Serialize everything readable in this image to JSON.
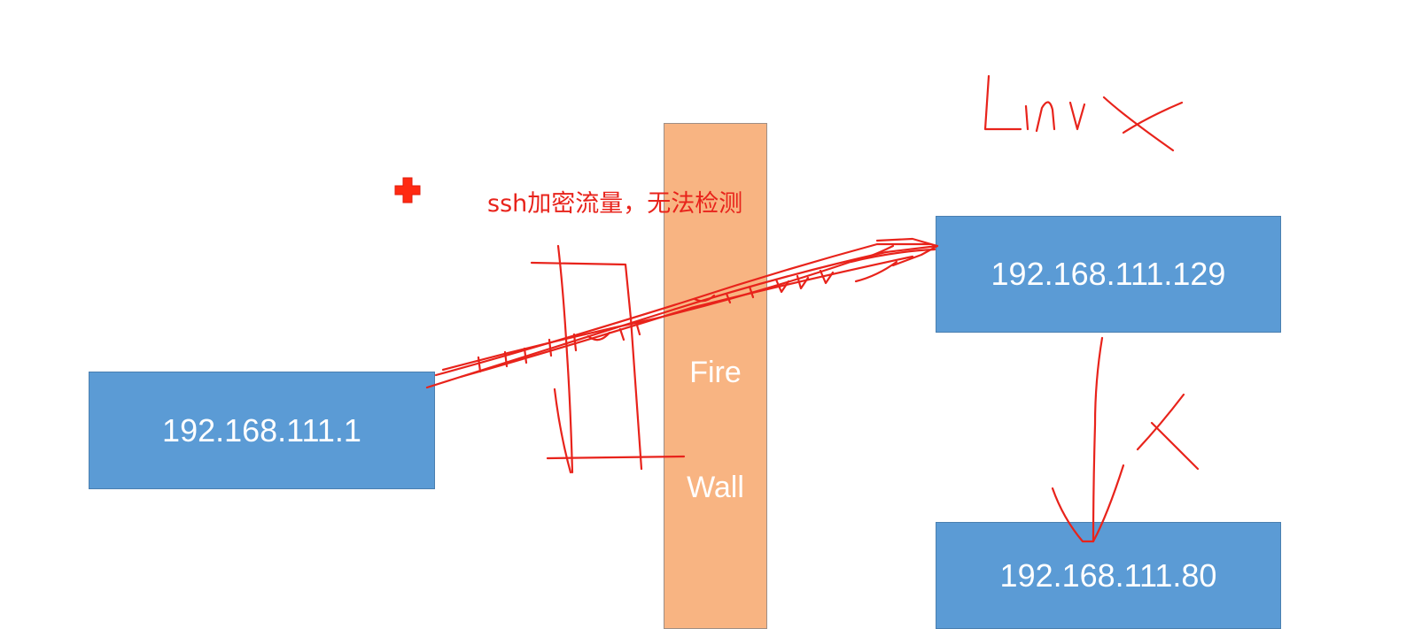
{
  "nodes": {
    "left": {
      "label": "192.168.111.1"
    },
    "right_top": {
      "label": "192.168.111.129"
    },
    "right_bottom": {
      "label": "192.168.111.80"
    }
  },
  "firewall": {
    "line1": "Fire",
    "line2": "Wall"
  },
  "annotation": {
    "text": "ssh加密流量，无法检测"
  },
  "handwriting": {
    "os_label": "Linux",
    "blocked_mark": "X"
  },
  "colors": {
    "node_fill": "#5b9bd5",
    "firewall_fill": "#f8b482",
    "ink": "#e8231b"
  },
  "icons": {
    "cursor": "red-cross-cursor-icon"
  }
}
